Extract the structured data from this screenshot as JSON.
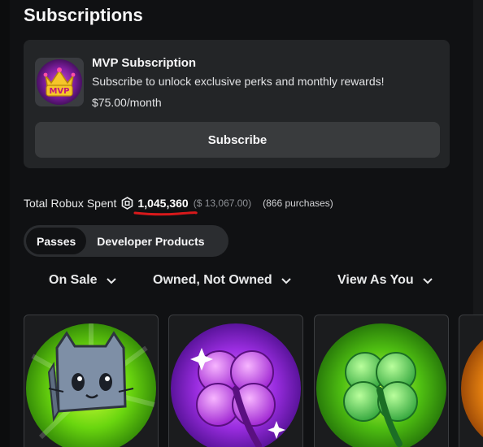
{
  "subscriptions": {
    "title": "Subscriptions",
    "card": {
      "name": "MVP Subscription",
      "description": "Subscribe to unlock exclusive perks and monthly rewards!",
      "price": "$75.00/month",
      "button_label": "Subscribe",
      "thumbnail_icon": "mvp-crown-icon",
      "thumbnail_text": "MVP"
    }
  },
  "spent": {
    "label": "Total Robux Spent",
    "currency_icon": "robux-icon",
    "amount": "1,045,360",
    "usd": "($ 13,067.00)",
    "purchases": "(866 purchases)",
    "highlight_color": "#d8191b"
  },
  "tabs": [
    {
      "label": "Passes",
      "active": true
    },
    {
      "label": "Developer Products",
      "active": false
    }
  ],
  "filters": [
    {
      "label": "On Sale"
    },
    {
      "label": "Owned, Not Owned"
    },
    {
      "label": "View As You"
    }
  ],
  "items": [
    {
      "icon": "blue-cat-icon"
    },
    {
      "icon": "purple-clover-icon"
    },
    {
      "icon": "green-clover-icon"
    },
    {
      "icon": "orange-item-icon"
    }
  ],
  "colors": {
    "background": "#101113",
    "card": "#232527",
    "button": "#393b3d",
    "accent_red": "#d8191b"
  }
}
